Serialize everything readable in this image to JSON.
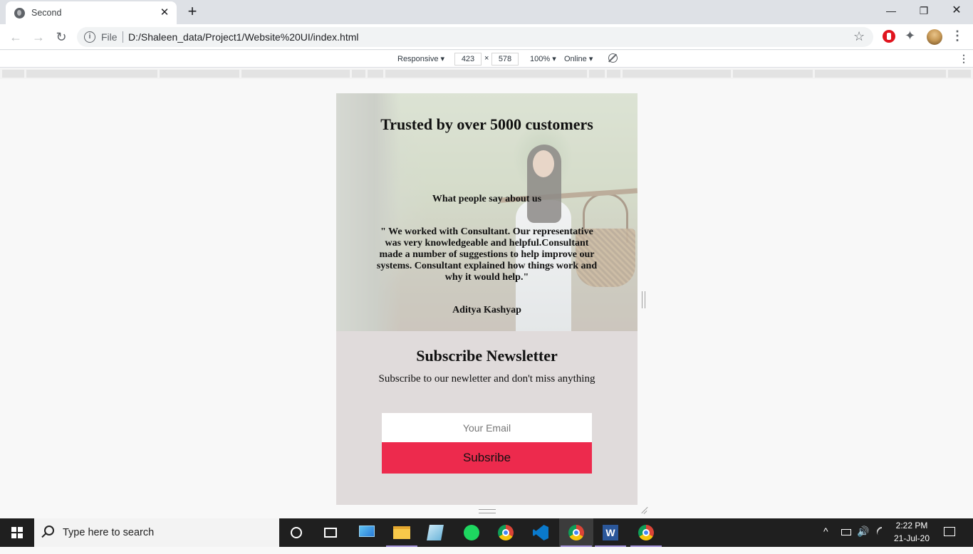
{
  "browser": {
    "tab_title": "Second",
    "tab_close": "✕",
    "new_tab": "+",
    "window_controls": {
      "minimize": "—",
      "maximize": "❐",
      "close": "✕"
    },
    "nav": {
      "back": "←",
      "forward": "→",
      "reload": "↻"
    },
    "omnibox": {
      "info_glyph": "i",
      "scheme_label": "File",
      "url": "D:/Shaleen_data/Project1/Website%20UI/index.html"
    },
    "icons": [
      "globe-icon",
      "star-icon",
      "adblock-icon",
      "puzzle-icon",
      "avatar",
      "more-icon"
    ],
    "star_glyph": "☆",
    "puzzle_glyph": "✦",
    "menu_glyph": "⋮"
  },
  "devtools": {
    "device_mode": "Responsive ▾",
    "width": "423",
    "times": "×",
    "height": "578",
    "zoom": "100% ▾",
    "network": "Online ▾",
    "more": "⋮"
  },
  "page": {
    "testimonial": {
      "heading": "Trusted by over 5000 customers",
      "subheading": "What people say about us",
      "quote": "\" We worked with Consultant. Our representative was very knowledgeable and helpful.Consultant made a number of suggestions to help improve our systems. Consultant explained how things work and why it would help.\"",
      "author": "Aditya Kashyap"
    },
    "newsletter": {
      "heading": "Subscribe Newsletter",
      "text": "Subscribe to our newletter and don't miss anything",
      "email_placeholder": "Your Email",
      "button_label": "Subsribe"
    },
    "colors": {
      "button": "#ed2a4d",
      "section_bg": "#e0dbdb"
    }
  },
  "taskbar": {
    "search_placeholder": "Type here to search",
    "apps": [
      "cortana-icon",
      "task-view-icon",
      "this-pc-icon",
      "file-explorer-icon",
      "app-icon",
      "spotify-icon",
      "chrome-icon",
      "vscode-icon",
      "chrome-active-icon",
      "word-icon",
      "chrome-icon-2"
    ],
    "word_glyph": "W",
    "tray_chevron": "^",
    "volume_glyph": "🔊",
    "time": "2:22 PM",
    "date": "21-Jul-20"
  }
}
